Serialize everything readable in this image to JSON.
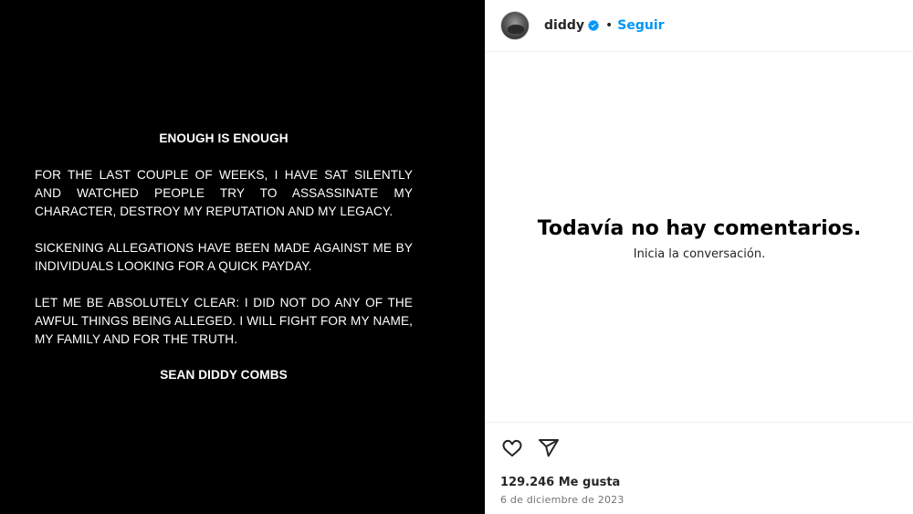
{
  "post": {
    "statement": {
      "headline": "ENOUGH IS ENOUGH",
      "paragraph_1": "FOR THE LAST COUPLE OF WEEKS, I HAVE SAT SILENTLY AND WATCHED PEOPLE TRY TO ASSASSINATE MY CHARACTER, DESTROY MY REPUTATION AND MY LEGACY.",
      "paragraph_2": "SICKENING ALLEGATIONS HAVE BEEN MADE AGAINST ME BY INDIVIDUALS LOOKING FOR A QUICK PAYDAY.",
      "paragraph_3": "LET ME BE ABSOLUTELY CLEAR: I DID NOT DO ANY OF THE AWFUL THINGS BEING ALLEGED. I WILL FIGHT FOR MY NAME, MY FAMILY AND FOR THE TRUTH.",
      "signature": "SEAN DIDDY COMBS"
    }
  },
  "header": {
    "username": "diddy",
    "separator": "•",
    "follow_label": "Seguir",
    "avatar_icon": "profile-avatar",
    "verified_icon": "verified-badge-icon"
  },
  "comments": {
    "empty_title": "Todavía no hay comentarios.",
    "empty_subtitle": "Inicia la conversación."
  },
  "footer": {
    "like_icon": "heart-icon",
    "share_icon": "share-icon",
    "likes_text": "129.246 Me gusta",
    "date_text": "6 de diciembre de 2023"
  },
  "colors": {
    "media_background": "#000000",
    "accent_blue": "#0095f6",
    "verified_blue": "#0095f6",
    "primary_text": "#262626",
    "secondary_text": "#737373",
    "divider": "#efefef"
  }
}
